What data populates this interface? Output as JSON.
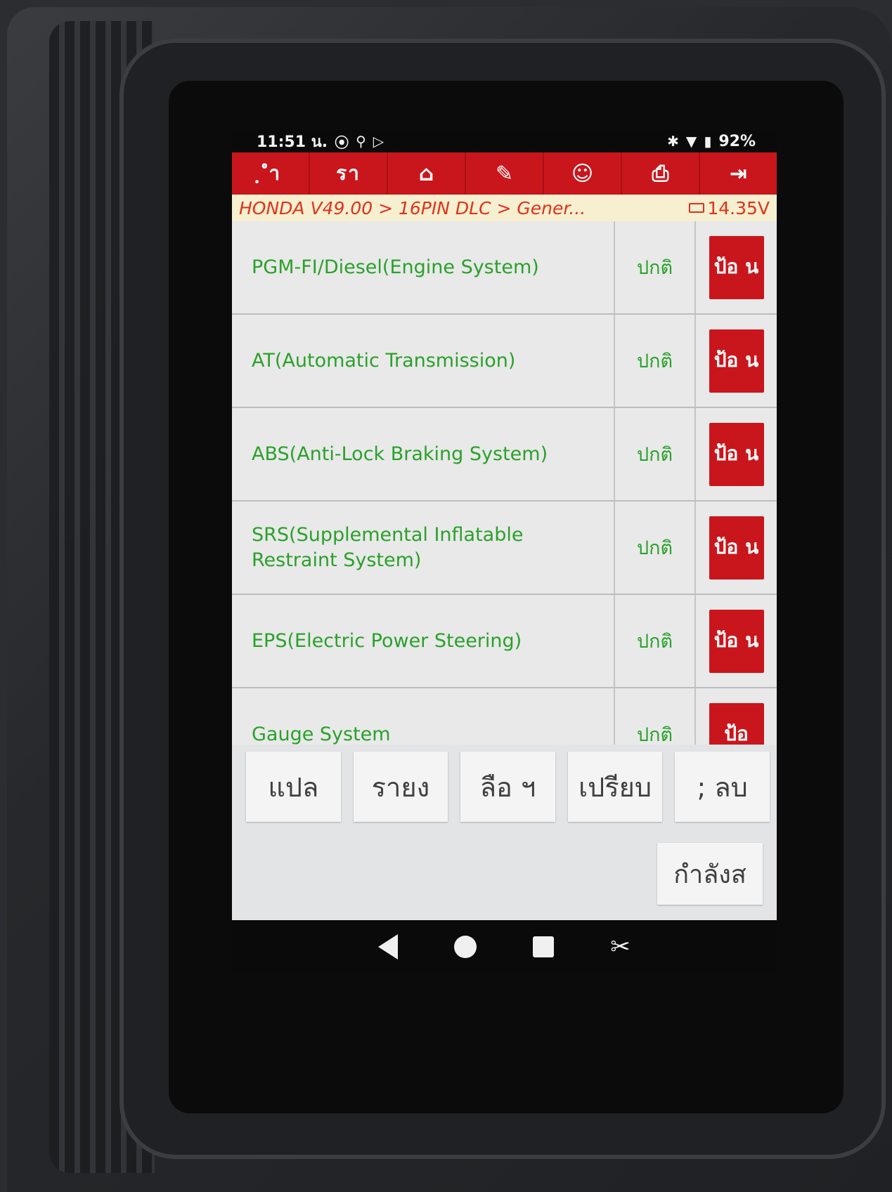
{
  "status_bar": {
    "time": "11:51 น.",
    "left_icons": [
      "⦿",
      "⚲",
      "▷"
    ],
    "battery": "92%",
    "right_icons": [
      "✱",
      "▼",
      "▮"
    ]
  },
  "toolbar": {
    "items": [
      {
        "label": "ฺ ํา",
        "icon": "prev-text"
      },
      {
        "label": "รา",
        "icon": "next-text"
      },
      {
        "label": "⌂",
        "icon": "home-icon"
      },
      {
        "label": "✎",
        "icon": "edit-icon"
      },
      {
        "label": "☺",
        "icon": "user-icon"
      },
      {
        "label": "⎙",
        "icon": "print-icon"
      },
      {
        "label": "⇥",
        "icon": "exit-icon"
      }
    ]
  },
  "breadcrumb": {
    "path": "HONDA V49.00 > 16PIN DLC > Gener...",
    "voltage": "14.35V"
  },
  "systems": [
    {
      "name": "PGM-FI/Diesel(Engine System)",
      "status": "ปกติ",
      "action": "ป้อ น"
    },
    {
      "name": "AT(Automatic Transmission)",
      "status": "ปกติ",
      "action": "ป้อ น"
    },
    {
      "name": "ABS(Anti-Lock Braking System)",
      "status": "ปกติ",
      "action": "ป้อ น"
    },
    {
      "name": "SRS(Supplemental Inflatable Restraint System)",
      "status": "ปกติ",
      "action": "ป้อ น"
    },
    {
      "name": "EPS(Electric Power Steering)",
      "status": "ปกติ",
      "action": "ป้อ น"
    },
    {
      "name": "Gauge System",
      "status": "ปกติ",
      "action": "ป้อ"
    }
  ],
  "bottom_buttons": [
    "แปล",
    "รายง",
    "ลือ ฯ",
    "เปรียบ",
    "; ลบ"
  ],
  "bottom_extra": "กำลังส",
  "colors": {
    "accent": "#c9161c",
    "ok_text": "#2aa12b",
    "crumb_bg": "#f6efd0"
  }
}
